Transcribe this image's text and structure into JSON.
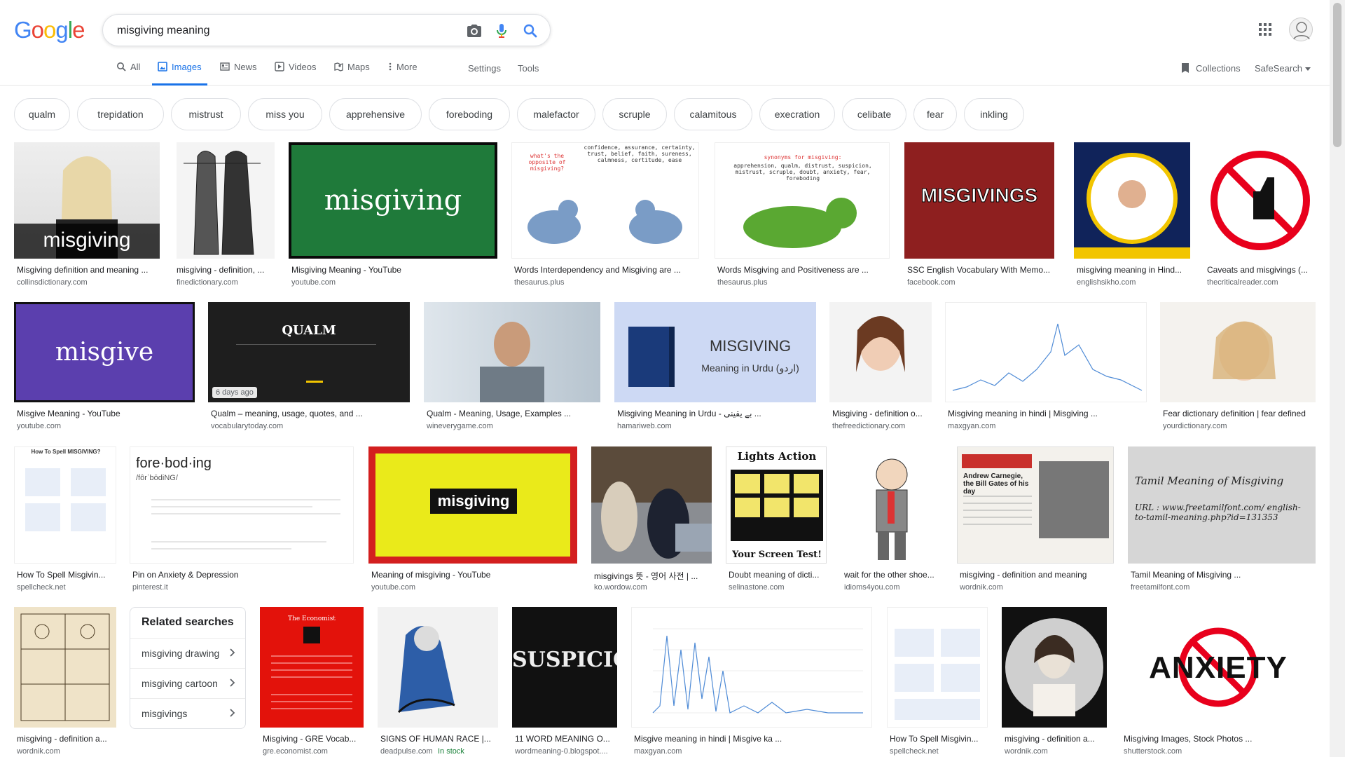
{
  "logo": {
    "text": [
      "G",
      "o",
      "o",
      "g",
      "l",
      "e"
    ]
  },
  "search": {
    "query": "misgiving meaning",
    "icons": [
      "camera-icon",
      "mic-icon",
      "search-icon"
    ]
  },
  "tabs": [
    {
      "label": "All",
      "icon": "search-icon"
    },
    {
      "label": "Images",
      "icon": "image-icon",
      "active": true
    },
    {
      "label": "News",
      "icon": "news-icon"
    },
    {
      "label": "Videos",
      "icon": "video-icon"
    },
    {
      "label": "Maps",
      "icon": "map-icon"
    },
    {
      "label": "More",
      "icon": "more-icon"
    }
  ],
  "tools": {
    "settings": "Settings",
    "tools": "Tools"
  },
  "right": {
    "collections": "Collections",
    "safesearch": "SafeSearch"
  },
  "chips": [
    "qualm",
    "trepidation",
    "mistrust",
    "miss you",
    "apprehensive",
    "foreboding",
    "malefactor",
    "scruple",
    "calamitous",
    "execration",
    "celibate",
    "fear",
    "inkling"
  ],
  "results": [
    {
      "caption": "Misgiving definition and meaning ...",
      "source": "collinsdictionary.com",
      "thumb_text": "misgiving"
    },
    {
      "caption": "misgiving - definition, ...",
      "source": "finedictionary.com"
    },
    {
      "caption": "Misgiving Meaning - YouTube",
      "source": "youtube.com",
      "thumb_text": "misgiving"
    },
    {
      "caption": "Words Interdependency and Misgiving are ...",
      "source": "thesaurus.plus",
      "thumb_text": "what's the opposite of misgiving?",
      "thumb_text2": "confidence, assurance, certainty, trust, belief, faith, sureness, calmness, certitude, ease"
    },
    {
      "caption": "Words Misgiving and Positiveness are ...",
      "source": "thesaurus.plus",
      "thumb_text": "synonyms for misgiving:",
      "thumb_text2": "apprehension, qualm, distrust, suspicion, mistrust, scruple, doubt, anxiety, fear, foreboding"
    },
    {
      "caption": "SSC English Vocabulary With Memo...",
      "source": "facebook.com",
      "thumb_text": "MISGIVINGS"
    },
    {
      "caption": "misgiving meaning in Hind...",
      "source": "englishsikho.com"
    },
    {
      "caption": "Caveats and misgivings (...",
      "source": "thecriticalreader.com"
    },
    {
      "caption": "Misgive Meaning - YouTube",
      "source": "youtube.com",
      "thumb_text": "misgive"
    },
    {
      "caption": "Qualm – meaning, usage, quotes, and ...",
      "source": "vocabularytoday.com",
      "thumb_text": "QUALM",
      "badge": "6 days ago"
    },
    {
      "caption": "Qualm - Meaning, Usage, Examples ...",
      "source": "wineverygame.com"
    },
    {
      "caption": "Misgiving Meaning in Urdu - بے یقینی ...",
      "source": "hamariweb.com",
      "thumb_text": "MISGIVING",
      "thumb_text2": "Meaning in Urdu (اردو)"
    },
    {
      "caption": "Misgiving - definition o...",
      "source": "thefreedictionary.com"
    },
    {
      "caption": "Misgiving meaning in hindi | Misgiving ...",
      "source": "maxgyan.com"
    },
    {
      "caption": "Fear dictionary definition | fear defined",
      "source": "yourdictionary.com"
    },
    {
      "caption": "How To Spell Misgivin...",
      "source": "spellcheck.net",
      "thumb_text": "How To Spell MISGIVING?"
    },
    {
      "caption": "Pin on Anxiety & Depression",
      "source": "pinterest.it",
      "thumb_text": "fore·bod·ing",
      "thumb_text2": "/fôrˈbōdiNG/"
    },
    {
      "caption": "Meaning of misgiving - YouTube",
      "source": "youtube.com",
      "thumb_text": "misgiving"
    },
    {
      "caption": "misgivings 뜻 - 영어 사전 | ...",
      "source": "ko.wordow.com"
    },
    {
      "caption": "Doubt meaning of dicti...",
      "source": "selinastone.com",
      "thumb_text": "Lights Action",
      "thumb_text2": "Your Screen Test!"
    },
    {
      "caption": "wait for the other shoe...",
      "source": "idioms4you.com"
    },
    {
      "caption": "misgiving - definition and meaning",
      "source": "wordnik.com",
      "thumb_text": "Andrew Carnegie, the Bill Gates of his day"
    },
    {
      "caption": "Tamil Meaning of Misgiving ...",
      "source": "freetamilfont.com",
      "thumb_text": "Tamil Meaning of Misgiving",
      "thumb_text2": "URL : www.freetamilfont.com/ english-to-tamil-meaning.php?id=131353"
    },
    {
      "caption": "misgiving - definition a...",
      "source": "wordnik.com"
    },
    {
      "caption": "Misgiving - GRE Vocab...",
      "source": "gre.economist.com",
      "thumb_text": "The Economist"
    },
    {
      "caption": "SIGNS OF HUMAN RACE |...",
      "source": "deadpulse.com",
      "stock": "In stock"
    },
    {
      "caption": "11 WORD MEANING O...",
      "source": "wordmeaning-0.blogspot....",
      "thumb_text": "SUSPICION"
    },
    {
      "caption": "Misgive meaning in hindi | Misgive ka ...",
      "source": "maxgyan.com"
    },
    {
      "caption": "How To Spell Misgivin...",
      "source": "spellcheck.net"
    },
    {
      "caption": "misgiving - definition a...",
      "source": "wordnik.com"
    },
    {
      "caption": "Misgiving Images, Stock Photos ...",
      "source": "shutterstock.com",
      "thumb_text": "ANXIETY"
    }
  ],
  "related": {
    "title": "Related searches",
    "items": [
      "misgiving drawing",
      "misgiving cartoon",
      "misgivings"
    ]
  }
}
